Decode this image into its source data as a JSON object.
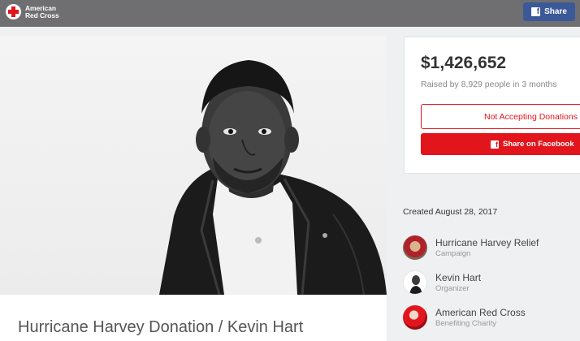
{
  "header": {
    "logo_line1": "American",
    "logo_line2": "Red Cross",
    "share_label": "Share",
    "share_icon": "facebook-icon"
  },
  "campaign": {
    "title": "Hurricane Harvey Donation / Kevin Hart",
    "amount_raised": "$1,426,652",
    "raised_summary": "Raised by 8,929 people in 3 months",
    "not_accepting_label": "Not Accepting Donations",
    "share_facebook_label": "Share on Facebook",
    "created": "Created August 28, 2017"
  },
  "people": [
    {
      "name": "Hurricane Harvey Relief",
      "role": "Campaign"
    },
    {
      "name": "Kevin Hart",
      "role": "Organizer"
    },
    {
      "name": "American Red Cross",
      "role": "Benefiting Charity"
    }
  ],
  "colors": {
    "brand_red": "#e3151c",
    "facebook_blue": "#3b5998",
    "header_gray": "#6f6f71"
  }
}
